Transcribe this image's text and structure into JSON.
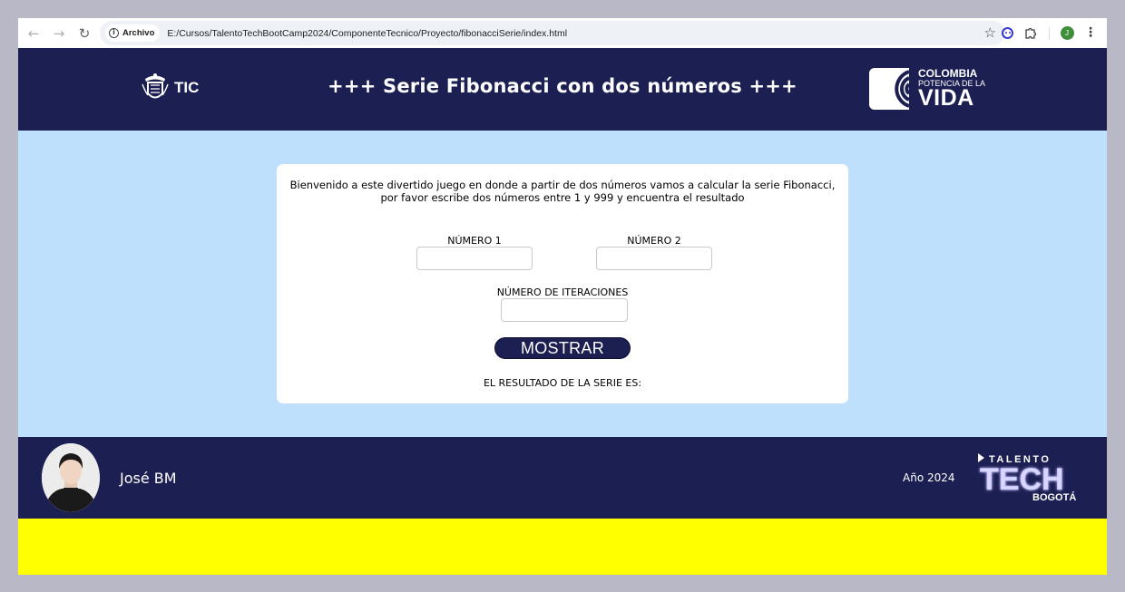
{
  "browser": {
    "chip_label": "Archivo",
    "url": "E:/Cursos/TalentoTechBootCamp2024/ComponenteTecnico/Proyecto/fibonacciSerie/index.html",
    "profile_initial": "J",
    "icons": [
      "back-arrow-icon",
      "forward-arrow-icon",
      "reload-icon",
      "info-icon",
      "star-icon",
      "extension-face-icon",
      "puzzle-icon",
      "menu-dots-icon"
    ]
  },
  "header": {
    "tic_label": "TIC",
    "title": "+++ Serie Fibonacci con dos números +++",
    "colombia": {
      "line1": "COLOMBIA",
      "line2": "POTENCIA DE LA",
      "line3": "VIDA"
    }
  },
  "form": {
    "intro_line1": "Bienvenido a este divertido juego en donde a partir de dos números vamos a calcular la serie Fibonacci,",
    "intro_line2": "por favor escribe dos números entre 1 y 999 y encuentra el resultado",
    "numero1_label": "NÚMERO 1",
    "numero1_value": "",
    "numero2_label": "NÚMERO 2",
    "numero2_value": "",
    "iteraciones_label": "NÚMERO DE ITERACIONES",
    "iteraciones_value": "",
    "button_label": "MOSTRAR",
    "result_label": "EL RESULTADO DE LA SERIE ES:"
  },
  "footer": {
    "author_name": "José BM",
    "year_text": "Año 2024",
    "logo": {
      "line1": "TALENTO",
      "line2": "TECH",
      "line3": "BOGOTÁ"
    }
  },
  "colors": {
    "navy": "#1c1f52",
    "page_bg": "#bee0fd",
    "card_bg": "#ffffff",
    "band": "#ffff00",
    "outer": "#b9b8c6"
  }
}
